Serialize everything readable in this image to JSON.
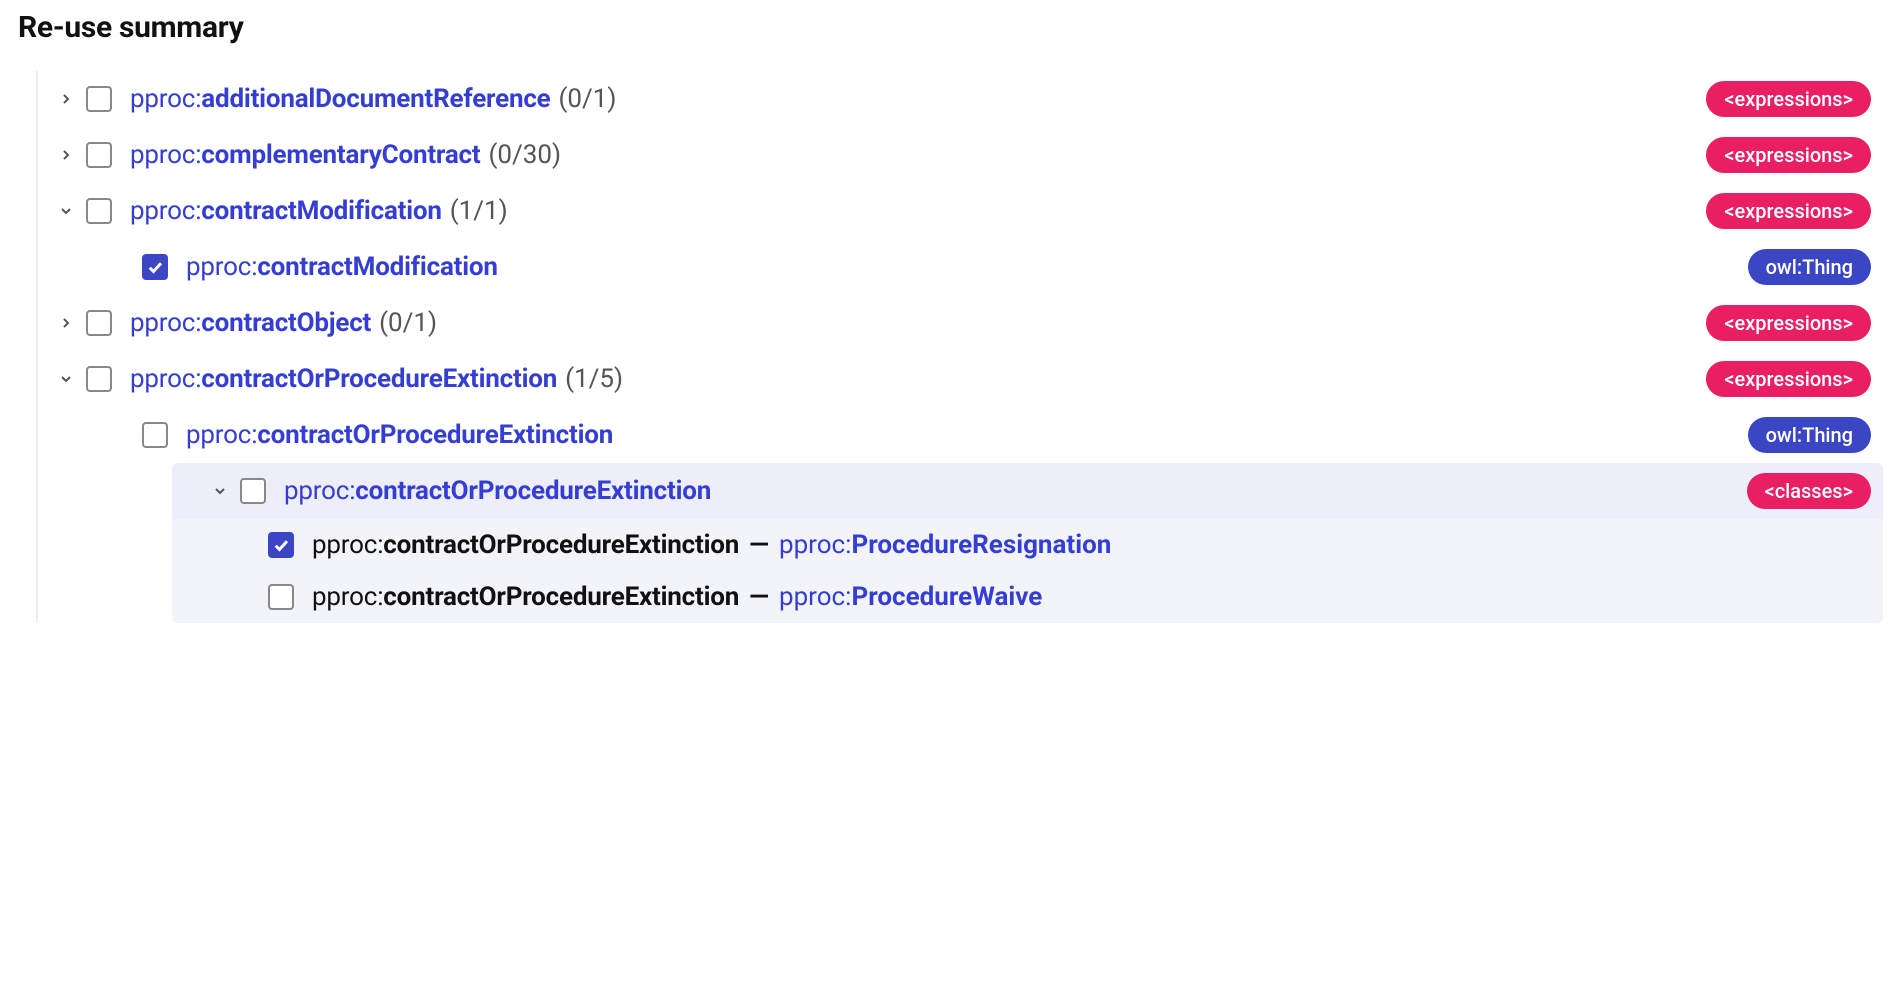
{
  "title": "Re-use summary",
  "badges": {
    "expressions": "<expressions>",
    "classes": "<classes>",
    "owlThing": "owl:Thing"
  },
  "dash": "—",
  "row0": {
    "prefix": "pproc:",
    "name": "additionalDocumentReference",
    "counts": "(0/1)"
  },
  "row1": {
    "prefix": "pproc:",
    "name": "complementaryContract",
    "counts": "(0/30)"
  },
  "row2": {
    "prefix": "pproc:",
    "name": "contractModification",
    "counts": "(1/1)"
  },
  "row2a": {
    "prefix": "pproc:",
    "name": "contractModification"
  },
  "row3": {
    "prefix": "pproc:",
    "name": "contractObject",
    "counts": "(0/1)"
  },
  "row4": {
    "prefix": "pproc:",
    "name": "contractOrProcedureExtinction",
    "counts": "(1/5)"
  },
  "row4a": {
    "prefix": "pproc:",
    "name": "contractOrProcedureExtinction"
  },
  "row4b": {
    "prefix": "pproc:",
    "name": "contractOrProcedureExtinction"
  },
  "row4b1": {
    "leftPrefix": "pproc:",
    "leftName": "contractOrProcedureExtinction",
    "rightPrefix": "pproc:",
    "rightName": "ProcedureResignation"
  },
  "row4b2": {
    "leftPrefix": "pproc:",
    "leftName": "contractOrProcedureExtinction",
    "rightPrefix": "pproc:",
    "rightName": "ProcedureWaive"
  }
}
